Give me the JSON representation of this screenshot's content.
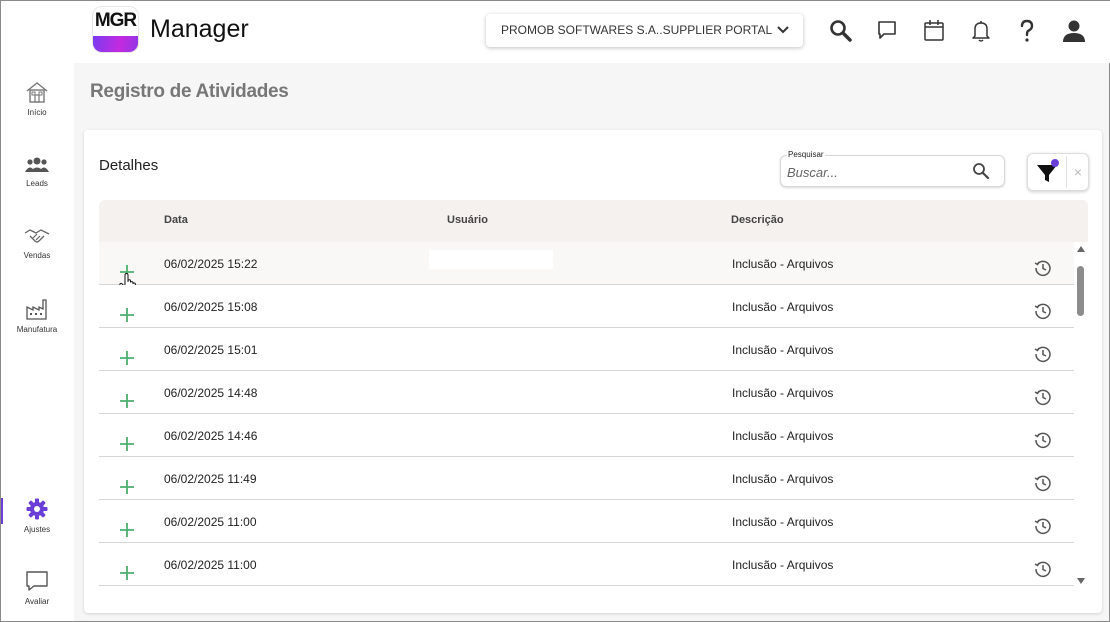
{
  "header": {
    "logo_text": "MGR",
    "app_name": "Manager",
    "portal_select": "PROMOB SOFTWARES S.A..SUPPLIER PORTAL"
  },
  "sidebar": {
    "items": [
      {
        "label": "Início",
        "icon": "home-icon"
      },
      {
        "label": "Leads",
        "icon": "people-icon"
      },
      {
        "label": "Vendas",
        "icon": "handshake-icon"
      },
      {
        "label": "Manufatura",
        "icon": "factory-icon"
      },
      {
        "label": "Ajustes",
        "icon": "gear-icon"
      },
      {
        "label": "Avaliar",
        "icon": "chat-icon"
      }
    ],
    "active_color": "#6b3fd6"
  },
  "page": {
    "title": "Registro de Atividades"
  },
  "card": {
    "title": "Detalhes",
    "search": {
      "label": "Pesquisar",
      "placeholder": "Buscar..."
    },
    "filter_clear": "×"
  },
  "table": {
    "columns": [
      "Data",
      "Usuário",
      "Descrição"
    ],
    "rows": [
      {
        "date": "06/02/2025 15:22",
        "user": "",
        "description": "Inclusão - Arquivos"
      },
      {
        "date": "06/02/2025 15:08",
        "user": "",
        "description": "Inclusão - Arquivos"
      },
      {
        "date": "06/02/2025 15:01",
        "user": "",
        "description": "Inclusão - Arquivos"
      },
      {
        "date": "06/02/2025 14:48",
        "user": "",
        "description": "Inclusão - Arquivos"
      },
      {
        "date": "06/02/2025 14:46",
        "user": "",
        "description": "Inclusão - Arquivos"
      },
      {
        "date": "06/02/2025 11:49",
        "user": "",
        "description": "Inclusão - Arquivos"
      },
      {
        "date": "06/02/2025 11:00",
        "user": "",
        "description": "Inclusão - Arquivos"
      },
      {
        "date": "06/02/2025 11:00",
        "user": "",
        "description": "Inclusão - Arquivos"
      }
    ],
    "plus_color": "#4caf6e"
  }
}
